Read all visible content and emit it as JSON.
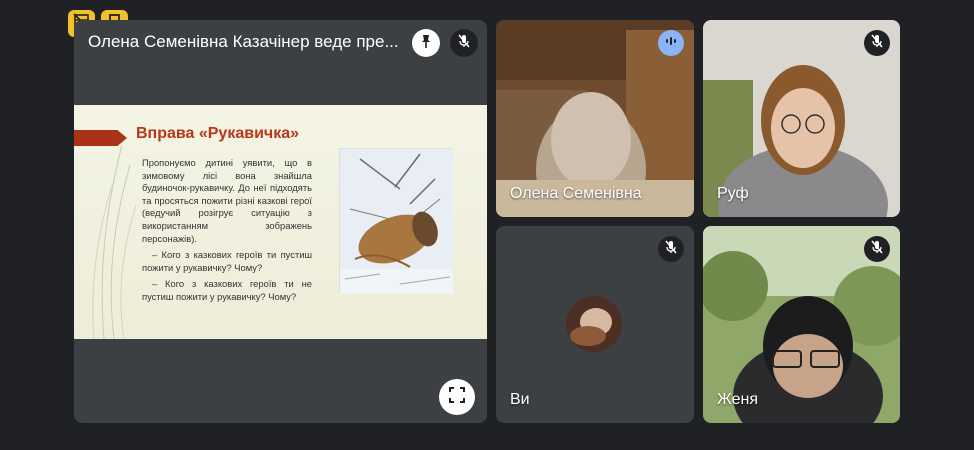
{
  "top_controls": [
    {
      "name": "layout-off-icon"
    },
    {
      "name": "exit-door-icon"
    }
  ],
  "presenter": {
    "title": "Олена Семенівна Казачінер веде пре...",
    "slide": {
      "title": "Вправа «Рукавичка»",
      "paragraph": "Пропонуємо дитині уявити, що в зимовому лісі вона знайшла будиночок-рукавичку. До неї підходять та просяться пожити різні казкові герої (ведучий розігрує ситуацію з використанням зображень персонажів).",
      "q1": "– Кого з казкових героїв ти пустиш пожити у рукавичку? Чому?",
      "q2": "– Кого з казкових героїв ти не пустиш пожити у рукавичку? Чому?"
    }
  },
  "participants": [
    {
      "name": "Олена Семенівна",
      "status": "speaking"
    },
    {
      "name": "Руф",
      "status": "muted"
    },
    {
      "name": "Ви",
      "status": "muted"
    },
    {
      "name": "Женя",
      "status": "muted"
    }
  ],
  "colors": {
    "background": "#202124",
    "tile": "#3c4043",
    "top_button": "#f2c028",
    "slide_accent": "#b8371b",
    "speaking_badge": "#8ab4f8"
  }
}
